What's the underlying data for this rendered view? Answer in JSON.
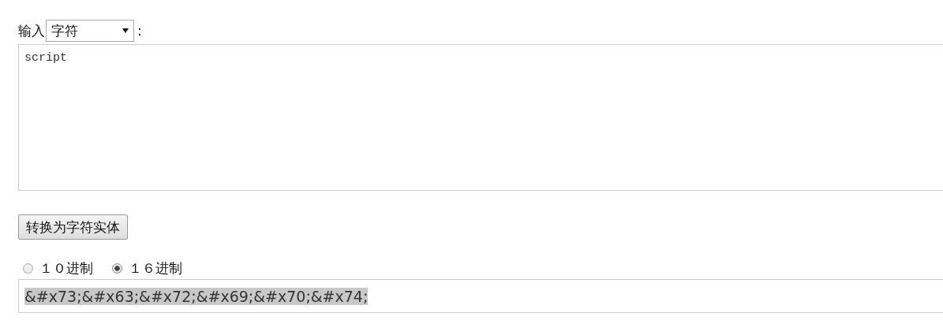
{
  "input_label": "输入",
  "input_type_select": {
    "value": "字符"
  },
  "colon": ":",
  "input_area": {
    "value": "script"
  },
  "convert_button": "转换为字符实体",
  "radix_options": [
    {
      "label": "１０进制",
      "selected": false
    },
    {
      "label": "１６进制",
      "selected": true
    }
  ],
  "output": {
    "value": "&#x73;&#x63;&#x72;&#x69;&#x70;&#x74;",
    "highlighted": true
  }
}
